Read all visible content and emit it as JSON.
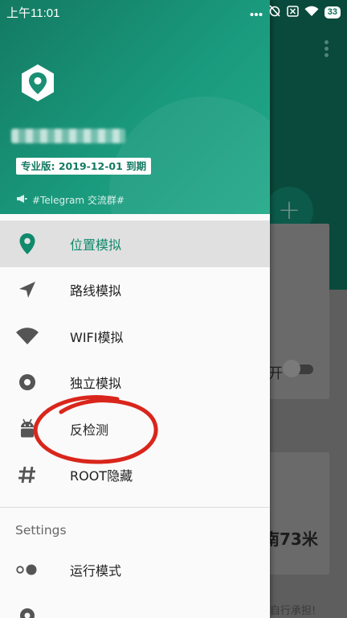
{
  "status_bar": {
    "time": "上午11:01",
    "battery": "33"
  },
  "drawer_header": {
    "badge": "专业版: 2019-12-01 到期",
    "telegram_link": "#Telegram 交流群#"
  },
  "menu": {
    "items": [
      {
        "label": "位置模拟",
        "icon": "location-pin-icon",
        "active": true
      },
      {
        "label": "路线模拟",
        "icon": "navigation-arrow-icon"
      },
      {
        "label": "WIFI模拟",
        "icon": "wifi-icon"
      },
      {
        "label": "独立模拟",
        "icon": "record-icon"
      },
      {
        "label": "反检测",
        "icon": "android-icon"
      },
      {
        "label": "ROOT隐藏",
        "icon": "hash-icon"
      }
    ],
    "settings_section": "Settings",
    "settings_items": [
      {
        "label": "运行模式",
        "icon": "toggle-dots-icon"
      }
    ]
  },
  "background": {
    "switch_text": "开",
    "distance_text": "南73米",
    "footer_text": "自行承担!"
  },
  "colors": {
    "primary": "#1a9a7d",
    "primary_dark": "#0a4a3c",
    "active_text": "#0f8a6c",
    "annotation": "#d9261c"
  }
}
